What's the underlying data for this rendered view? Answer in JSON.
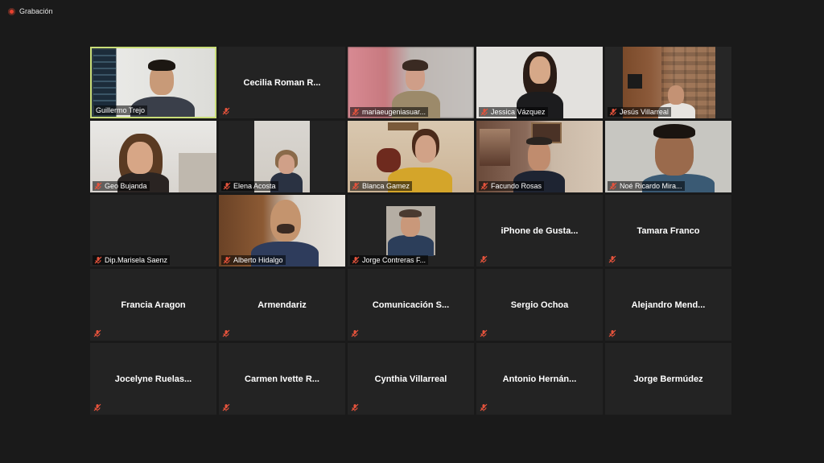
{
  "recording": {
    "label": "Grabación"
  },
  "participants": [
    {
      "name": "Guillermo Trejo",
      "video": true
    },
    {
      "name": "Cecilia Roman R...",
      "video": false
    },
    {
      "name": "mariaeugeniasuar...",
      "video": true
    },
    {
      "name": "Jessica Vázquez",
      "video": true
    },
    {
      "name": "Jesús Villarreal",
      "video": true
    },
    {
      "name": "Geo Bujanda",
      "video": true
    },
    {
      "name": "Elena Acosta",
      "video": true
    },
    {
      "name": "Blanca Gamez",
      "video": true
    },
    {
      "name": "Facundo Rosas",
      "video": true
    },
    {
      "name": "Noé Ricardo Mira...",
      "video": true
    },
    {
      "name": "Dip.Marisela Saenz",
      "video": false
    },
    {
      "name": "Alberto Hidalgo",
      "video": true
    },
    {
      "name": "Jorge Contreras F...",
      "video": true
    },
    {
      "name": "iPhone de Gusta...",
      "video": false
    },
    {
      "name": "Tamara Franco",
      "video": false
    },
    {
      "name": "Francia Aragon",
      "video": false
    },
    {
      "name": "Armendariz",
      "video": false
    },
    {
      "name": "Comunicación S...",
      "video": false
    },
    {
      "name": "Sergio Ochoa",
      "video": false
    },
    {
      "name": "Alejandro Mend...",
      "video": false
    },
    {
      "name": "Jocelyne Ruelas...",
      "video": false
    },
    {
      "name": "Carmen Ivette R...",
      "video": false
    },
    {
      "name": "Cynthia Villarreal",
      "video": false
    },
    {
      "name": "Antonio Hernán...",
      "video": false
    },
    {
      "name": "Jorge Bermúdez",
      "video": false
    }
  ],
  "colors": {
    "active_border": "#c9dd78",
    "muted_mic": "#e5533c",
    "background": "#1a1a1a",
    "tile": "#232323"
  }
}
